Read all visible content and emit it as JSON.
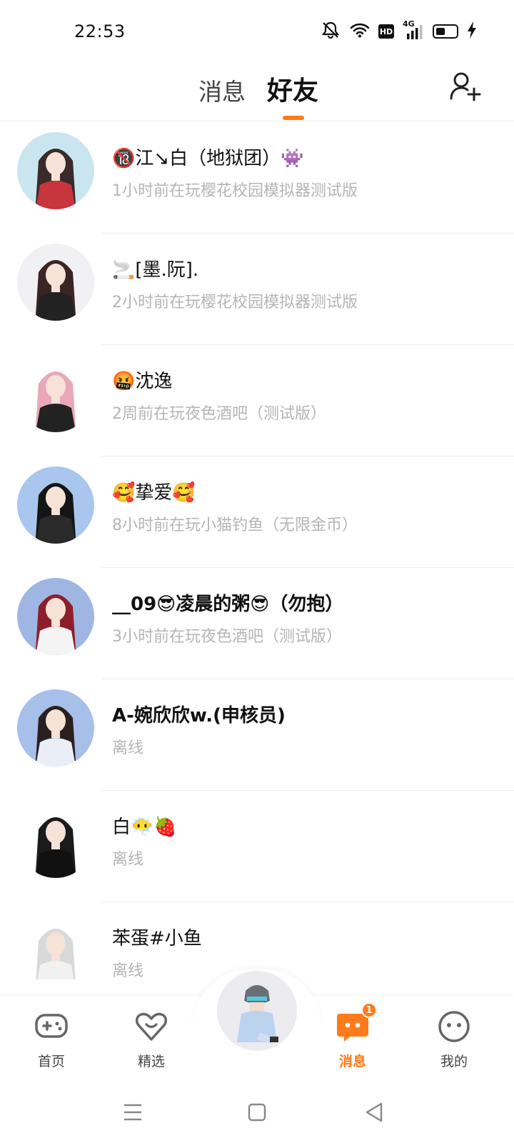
{
  "status_bar": {
    "time": "22:53",
    "network": "4G",
    "hd": "HD",
    "battery_level": 0.45
  },
  "header": {
    "tabs": [
      {
        "label": "消息",
        "active": false
      },
      {
        "label": "好友",
        "active": true
      }
    ],
    "accent_color": "#ff7a1a",
    "add_friend_icon": "add-user-icon"
  },
  "friends": [
    {
      "name": "🔞江↘白（地狱团）👾",
      "status": "1小时前在玩樱花校园模拟器测试版",
      "avatar_bg": "#c9e6f0"
    },
    {
      "name": "🚬[墨.阮].",
      "status": "2小时前在玩樱花校园模拟器测试版",
      "avatar_bg": "#f1f1f3"
    },
    {
      "name": "🤬沈逸",
      "status": "2周前在玩夜色酒吧（测试版）",
      "avatar_bg": "#ffffff"
    },
    {
      "name": "🥰挚爱🥰",
      "status": "8小时前在玩小猫钓鱼（无限金币）",
      "avatar_bg": "#a9c6ee"
    },
    {
      "name": "__09😎凌晨的粥😎（勿抱）",
      "status": "3小时前在玩夜色酒吧（测试版）",
      "avatar_bg": "#9fb6e3"
    },
    {
      "name": "A-婉欣欣w.(申核员)",
      "status": "离线",
      "avatar_bg": "#a7c0ea"
    },
    {
      "name": "白😶‍🌫️🍓",
      "status": "离线",
      "avatar_bg": "#ffffff"
    },
    {
      "name": "苯蛋#小鱼",
      "status": "离线",
      "avatar_bg": "#ffffff"
    }
  ],
  "bottom_nav": {
    "items": [
      {
        "label": "首页",
        "icon": "gamepad-icon"
      },
      {
        "label": "精选",
        "icon": "heart-icon"
      },
      {
        "label": "消息",
        "icon": "chat-icon",
        "badge": "1",
        "active": true
      },
      {
        "label": "我的",
        "icon": "smiley-face-icon"
      }
    ]
  }
}
